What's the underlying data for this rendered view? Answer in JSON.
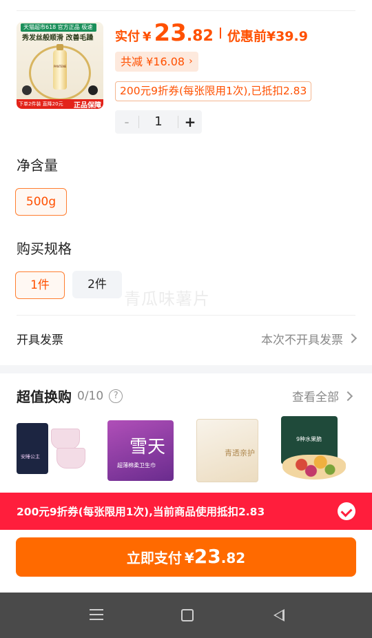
{
  "product": {
    "image_banner": "天猫超市618 官方正品 极速送达",
    "image_title": "秀发丝般顺滑 改善毛躁",
    "image_brand": "PANTENE",
    "image_bottom_left": "下单2件装 直降20元",
    "image_bottom_right": "正品保障"
  },
  "price": {
    "label": "实付",
    "currency": "¥",
    "integer": "23",
    "decimal": ".82",
    "before_label": "优惠前",
    "before_value": "¥39.9",
    "total_off": "共减 ¥16.08",
    "total_off_chevron": "›",
    "coupon_tag": "200元9折券(每张限用1次),已抵扣2.83"
  },
  "stepper": {
    "minus": "-",
    "value": "1",
    "plus": "+"
  },
  "net_content": {
    "title": "净含量",
    "options": [
      {
        "label": "500g",
        "selected": true
      }
    ]
  },
  "spec": {
    "title": "购买规格",
    "options": [
      {
        "label": "1件",
        "selected": true
      },
      {
        "label": "2件",
        "selected": false
      }
    ]
  },
  "watermark": "青瓜味薯片",
  "invoice": {
    "label": "开具发票",
    "value": "本次不开具发票"
  },
  "swap": {
    "title": "超值换购",
    "count": "0/10",
    "help_glyph": "?",
    "view_all": "查看全部",
    "items": [
      {
        "icon": "sanitary-pants-product",
        "text": "安睡公主"
      },
      {
        "icon": "sanitary-pad-product",
        "text": "雪天",
        "sub": "超薄棉柔卫生巾"
      },
      {
        "icon": "tissue-pack-product",
        "text": "青透亲护"
      },
      {
        "icon": "dried-fruit-product",
        "text": "9种水果脆"
      }
    ]
  },
  "coupon_banner": {
    "text": "200元9折券(每张限用1次),当前商品使用抵扣2.83",
    "checked": true
  },
  "pay_button": {
    "label": "立即支付",
    "currency": "¥",
    "integer": "23",
    "decimal": ".82"
  },
  "colors": {
    "accent": "#ff5000",
    "pay_button": "#ff6a00",
    "coupon_banner": "#ff1e3c",
    "nav_bar": "#4a4a4a"
  }
}
